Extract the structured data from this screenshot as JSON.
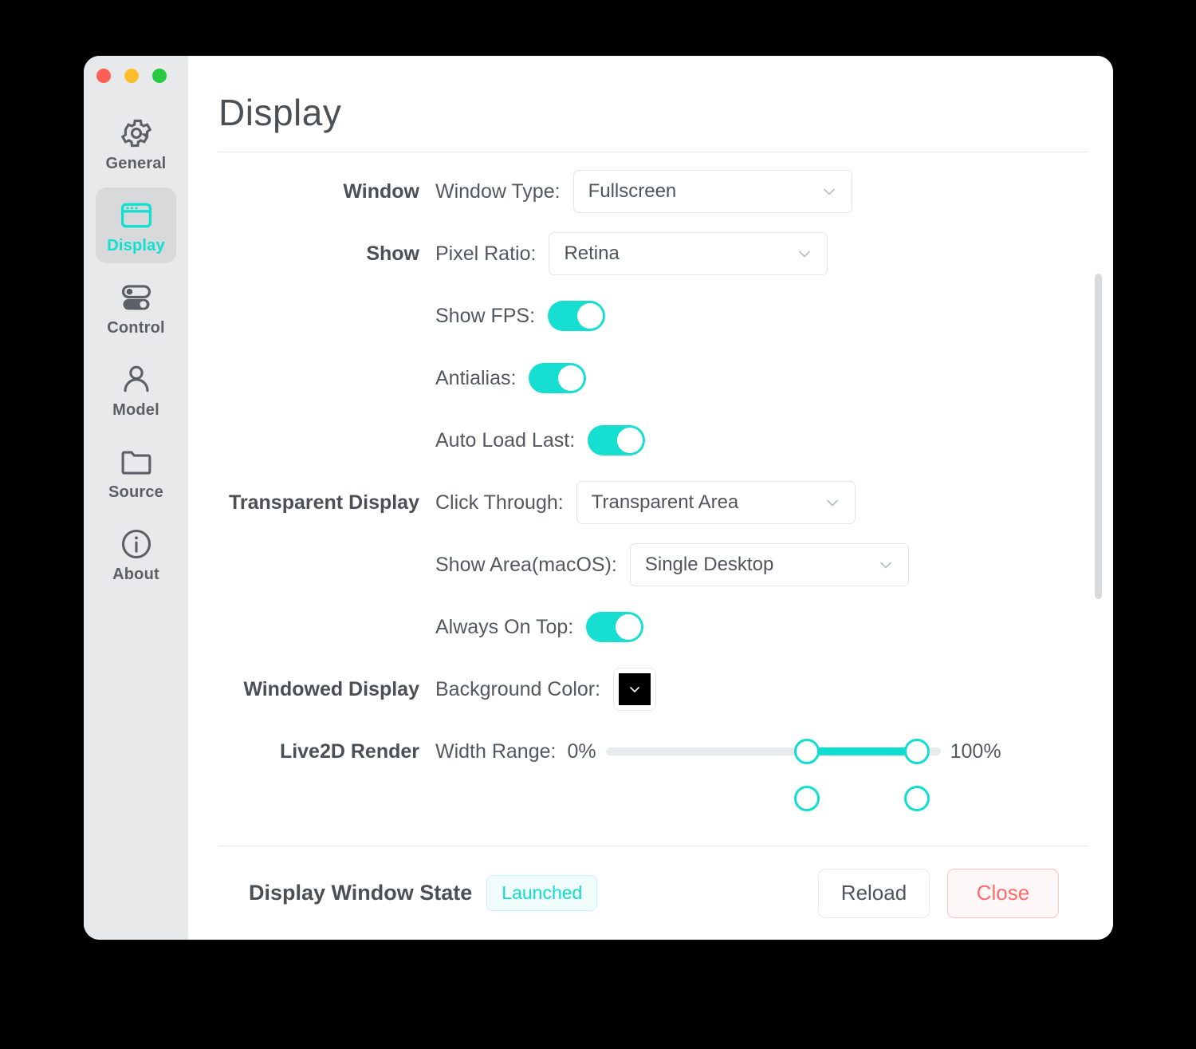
{
  "window": {
    "traffic_lights": [
      {
        "name": "close",
        "color": "#ff5f57"
      },
      {
        "name": "minimize",
        "color": "#ffbd2e"
      },
      {
        "name": "zoom",
        "color": "#28c840"
      }
    ],
    "accent_color": "#10ded0",
    "danger_color": "#ff6b6b"
  },
  "sidebar": {
    "items": [
      {
        "label": "General",
        "icon": "gear-icon",
        "active": false
      },
      {
        "label": "Display",
        "icon": "window-icon",
        "active": true
      },
      {
        "label": "Control",
        "icon": "toggles-icon",
        "active": false
      },
      {
        "label": "Model",
        "icon": "person-icon",
        "active": false
      },
      {
        "label": "Source",
        "icon": "folder-icon",
        "active": false
      },
      {
        "label": "About",
        "icon": "info-icon",
        "active": false
      }
    ]
  },
  "header": {
    "title": "Display"
  },
  "sections": {
    "window": {
      "group_label": "Window",
      "window_type": {
        "label": "Window Type:",
        "value": "Fullscreen"
      }
    },
    "show": {
      "group_label": "Show",
      "pixel_ratio": {
        "label": "Pixel Ratio:",
        "value": "Retina"
      },
      "show_fps": {
        "label": "Show FPS:",
        "value": "on"
      },
      "antialias": {
        "label": "Antialias:",
        "value": "on"
      },
      "auto_load_last": {
        "label": "Auto Load Last:",
        "value": "on"
      }
    },
    "transparent_display": {
      "group_label": "Transparent Display",
      "click_through": {
        "label": "Click Through:",
        "value": "Transparent Area"
      },
      "show_area": {
        "label": "Show Area(macOS):",
        "value": "Single Desktop"
      },
      "always_on_top": {
        "label": "Always On Top:",
        "value": "on"
      }
    },
    "windowed_display": {
      "group_label": "Windowed Display",
      "background_color": {
        "label": "Background Color:",
        "value": "#000000"
      }
    },
    "live2d_render": {
      "group_label": "Live2D Render",
      "width_range": {
        "label": "Width Range:",
        "min_label": "0%",
        "max_label": "100%",
        "low": 60,
        "high": 93
      }
    }
  },
  "footer": {
    "state_label": "Display Window State",
    "state_badge": "Launched",
    "reload_label": "Reload",
    "close_label": "Close"
  }
}
